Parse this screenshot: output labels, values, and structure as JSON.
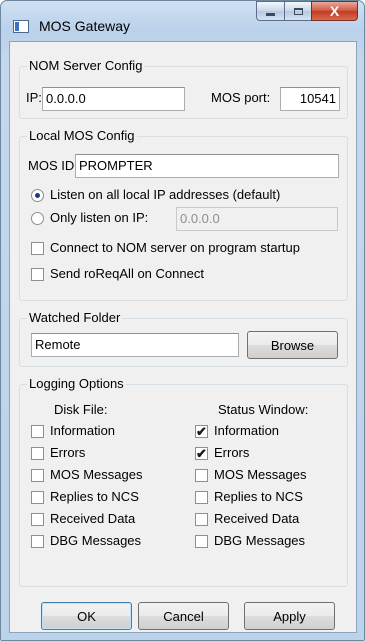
{
  "window": {
    "title": "MOS Gateway",
    "icons": {
      "app": "app-icon",
      "minimize": "minimize-icon",
      "maximize": "maximize-icon",
      "close": "close-icon"
    },
    "close_glyph": "X"
  },
  "nom_server": {
    "legend": "NOM Server Config",
    "ip_label": "IP:",
    "ip_value": "0.0.0.0",
    "port_label": "MOS port:",
    "port_value": "10541"
  },
  "local_mos": {
    "legend": "Local MOS Config",
    "mos_id_label": "MOS ID:",
    "mos_id_value": "PROMPTER",
    "listen_all_label": "Listen on all local IP addresses (default)",
    "listen_all_selected": true,
    "only_ip_label": "Only listen on IP:",
    "only_ip_selected": false,
    "only_ip_value": "0.0.0.0",
    "connect_startup_label": "Connect to NOM server on program startup",
    "connect_startup_checked": false,
    "send_roreq_label": "Send roReqAll on Connect",
    "send_roreq_checked": false
  },
  "watched_folder": {
    "legend": "Watched Folder",
    "value": "Remote",
    "browse_label": "Browse"
  },
  "logging": {
    "legend": "Logging Options",
    "disk_header": "Disk File:",
    "status_header": "Status Window:",
    "check_glyph": "✔",
    "options": [
      {
        "label": "Information",
        "disk": false,
        "status": true
      },
      {
        "label": "Errors",
        "disk": false,
        "status": true
      },
      {
        "label": "MOS Messages",
        "disk": false,
        "status": false
      },
      {
        "label": "Replies to NCS",
        "disk": false,
        "status": false
      },
      {
        "label": "Received Data",
        "disk": false,
        "status": false
      },
      {
        "label": "DBG Messages",
        "disk": false,
        "status": false
      }
    ]
  },
  "buttons": {
    "ok": "OK",
    "cancel": "Cancel",
    "apply": "Apply"
  }
}
